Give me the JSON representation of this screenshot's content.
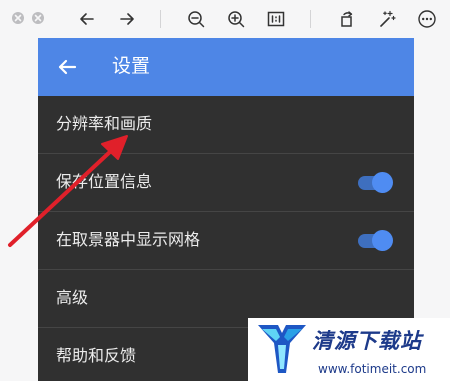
{
  "viewer_toolbar": {
    "icons": [
      "close-icon",
      "minimize-icon",
      "arrow-left-icon",
      "arrow-right-icon",
      "zoom-out-icon",
      "zoom-in-icon",
      "actual-size-icon",
      "rotate-icon",
      "magic-wand-icon",
      "more-icon"
    ]
  },
  "app_bar": {
    "title": "设置",
    "background": "#4e86e6"
  },
  "settings": {
    "items": [
      {
        "label": "分辨率和画质"
      },
      {
        "label": "保存位置信息",
        "toggle": true
      },
      {
        "label": "在取景器中显示网格",
        "toggle": true
      },
      {
        "label": "高级"
      },
      {
        "label": "帮助和反馈"
      }
    ]
  },
  "watermark": {
    "brand": "清源下载站",
    "url": "www.fotimeit.com"
  },
  "colors": {
    "accent_blue": "#4e86e6",
    "panel_dark": "#303030",
    "annotation_red": "#e0202a"
  }
}
